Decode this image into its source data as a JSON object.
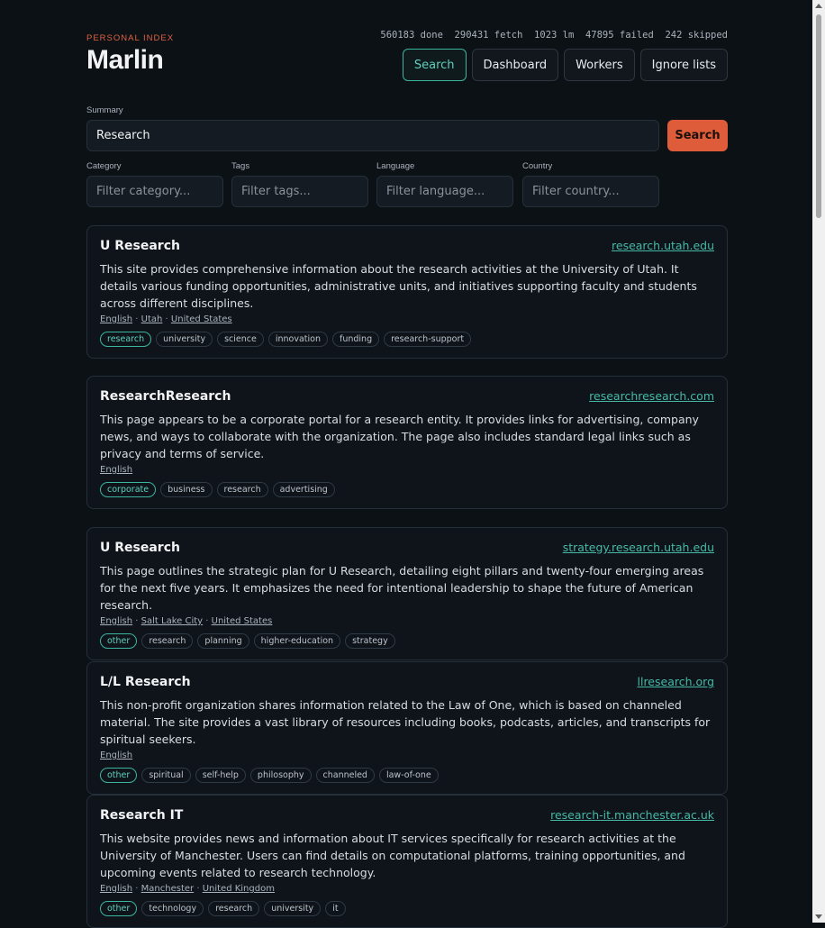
{
  "header": {
    "eyebrow": "PERSONAL INDEX",
    "title": "Marlin",
    "stats": "560183 done  290431 fetch  1023 lm  47895 failed  242 skipped"
  },
  "nav": {
    "search": "Search",
    "dashboard": "Dashboard",
    "workers": "Workers",
    "ignore_lists": "Ignore lists"
  },
  "search": {
    "summary_label": "Summary",
    "summary_value": "Research",
    "button": "Search",
    "category_label": "Category",
    "category_placeholder": "Filter category...",
    "tags_label": "Tags",
    "tags_placeholder": "Filter tags...",
    "language_label": "Language",
    "language_placeholder": "Filter language...",
    "country_label": "Country",
    "country_placeholder": "Filter country..."
  },
  "results": [
    {
      "title": "U Research",
      "url": "research.utah.edu",
      "desc": "This site provides comprehensive information about the research activities at the University of Utah. It details various funding opportunities, administrative units, and initiatives supporting faculty and students across different disciplines.",
      "meta": [
        "English",
        "Utah",
        "United States"
      ],
      "tags": [
        "research",
        "university",
        "science",
        "innovation",
        "funding",
        "research-support"
      ]
    },
    {
      "title": "ResearchResearch",
      "url": "researchresearch.com",
      "desc": "This page appears to be a corporate portal for a research entity. It provides links for advertising, company news, and ways to collaborate with the organization. The page also includes standard legal links such as privacy and terms of service.",
      "meta": [
        "English"
      ],
      "tags": [
        "corporate",
        "business",
        "research",
        "advertising"
      ]
    },
    {
      "title": "U Research",
      "url": "strategy.research.utah.edu",
      "desc": "This page outlines the strategic plan for U Research, detailing eight pillars and twenty-four emerging areas for the next five years. It emphasizes the need for intentional leadership to shape the future of American research.",
      "meta": [
        "English",
        "Salt Lake City",
        "United States"
      ],
      "tags": [
        "other",
        "research",
        "planning",
        "higher-education",
        "strategy"
      ]
    },
    {
      "title": "L/L Research",
      "url": "llresearch.org",
      "desc": "This non-profit organization shares information related to the Law of One, which is based on channeled material. The site provides a vast library of resources including books, podcasts, articles, and transcripts for spiritual seekers.",
      "meta": [
        "English"
      ],
      "tags": [
        "other",
        "spiritual",
        "self-help",
        "philosophy",
        "channeled",
        "law-of-one"
      ]
    },
    {
      "title": "Research IT",
      "url": "research-it.manchester.ac.uk",
      "desc": "This website provides news and information about IT services specifically for research activities at the University of Manchester. Users can find details on computational platforms, training opportunities, and upcoming events related to research technology.",
      "meta": [
        "English",
        "Manchester",
        "United Kingdom"
      ],
      "tags": [
        "other",
        "technology",
        "research",
        "university",
        "it"
      ]
    }
  ]
}
